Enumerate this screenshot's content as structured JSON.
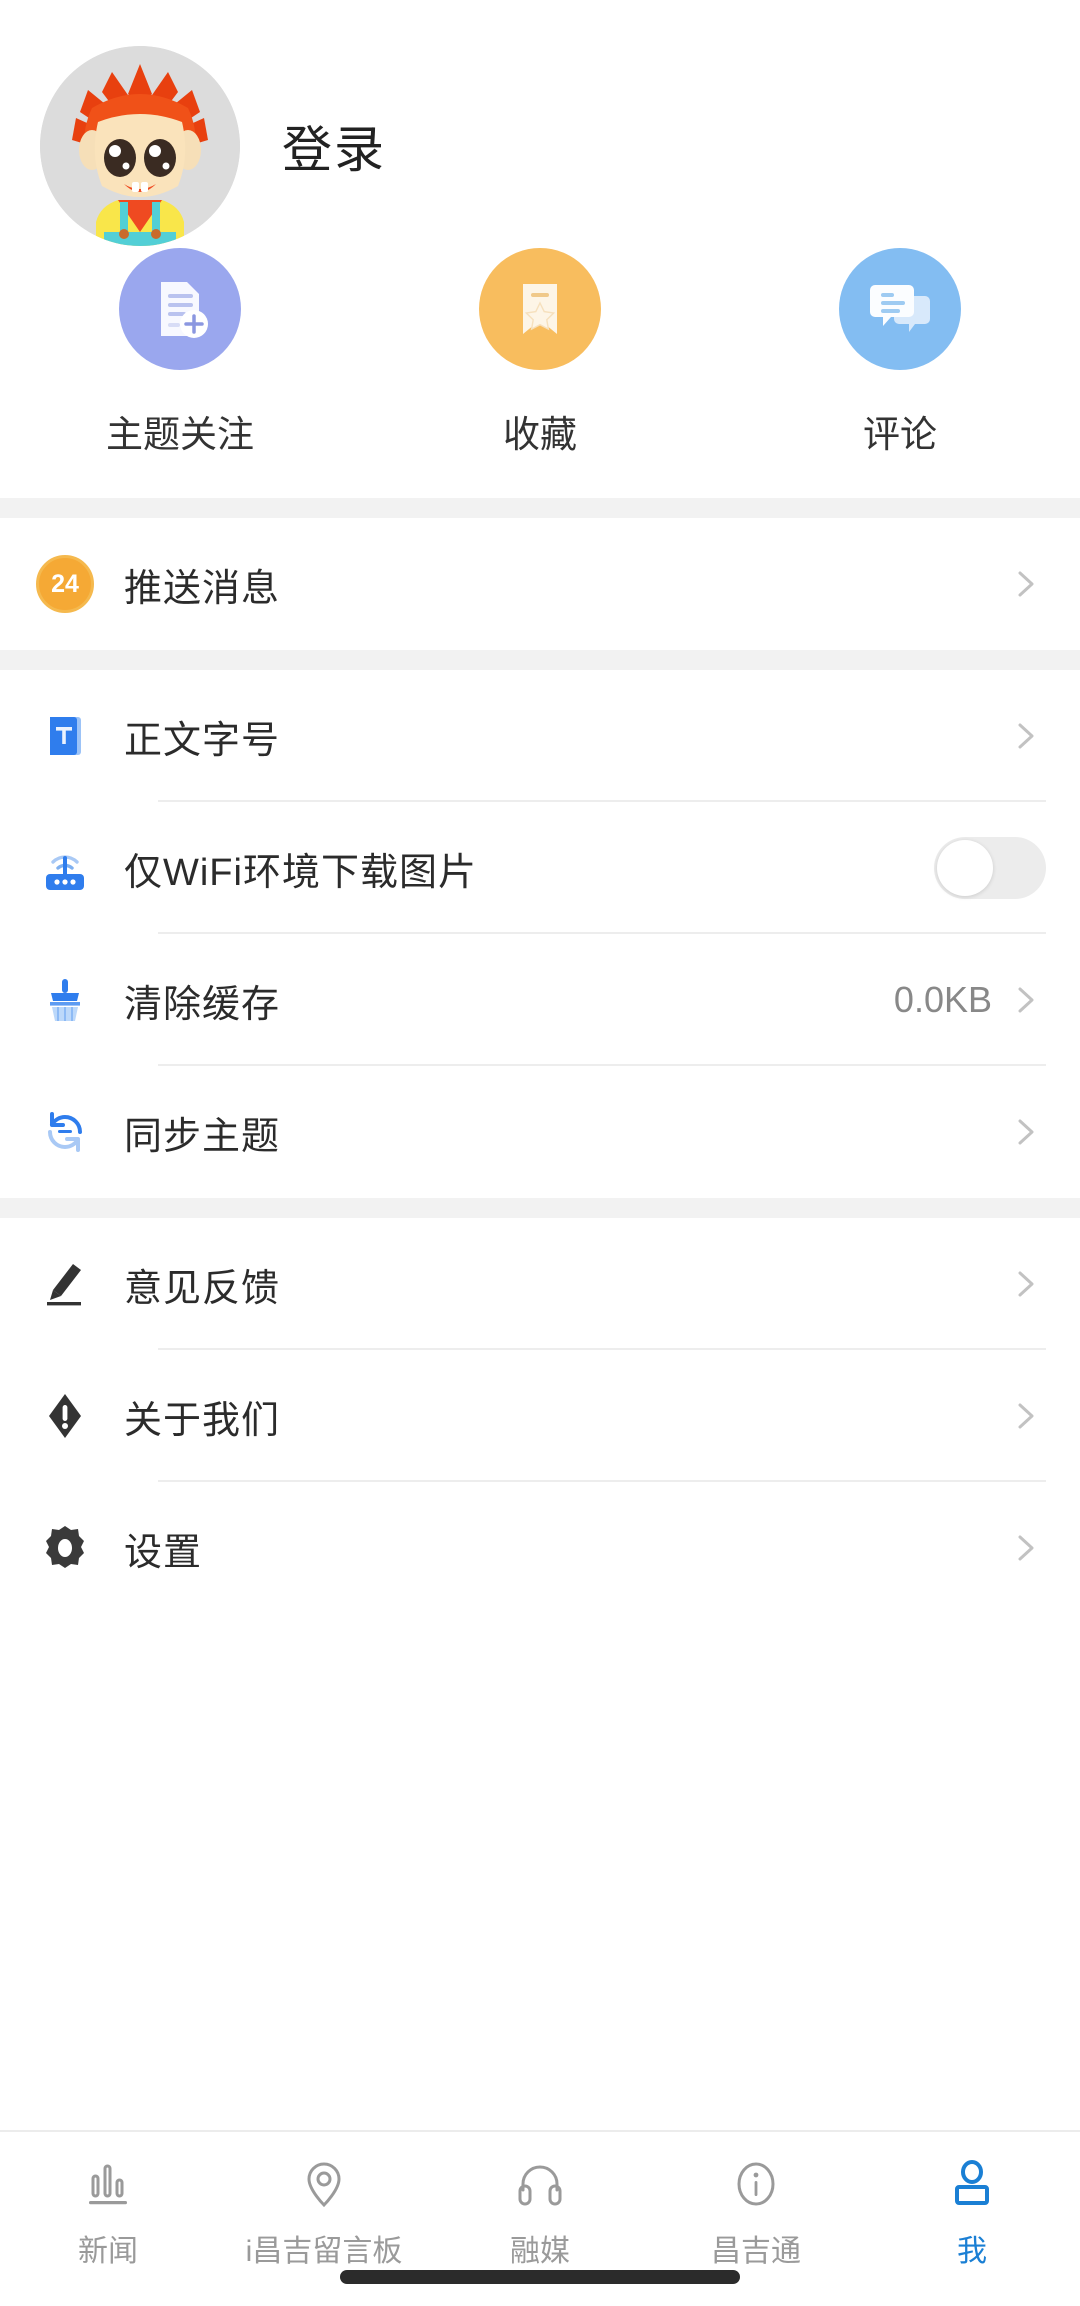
{
  "profile": {
    "avatar_icon": "mascot-avatar",
    "login_label": "登录"
  },
  "quick_actions": [
    {
      "icon": "document-add-icon",
      "label": "主题关注",
      "color": "#9aa7ee"
    },
    {
      "icon": "bookmark-star-icon",
      "label": "收藏",
      "color": "#f7b košice"
    },
    {
      "icon": "comments-icon",
      "label": "评论",
      "color": "#83bdf2"
    }
  ],
  "quick_action_colors": {
    "follow": "#9aa7ee",
    "favorite": "#f8bd5e",
    "comment": "#83bdf2"
  },
  "sections": [
    {
      "name": "messages",
      "rows": [
        {
          "icon": "badge-24-icon",
          "label": "推送消息",
          "value": "",
          "control": "chevron",
          "badge": "24"
        }
      ]
    },
    {
      "name": "preferences",
      "rows": [
        {
          "icon": "text-size-book-icon",
          "label": "正文字号",
          "value": "",
          "control": "chevron"
        },
        {
          "icon": "wifi-router-icon",
          "label": "仅WiFi环境下载图片",
          "value": "",
          "control": "toggle",
          "toggle_on": false
        },
        {
          "icon": "broom-clean-icon",
          "label": "清除缓存",
          "value": "0.0KB",
          "control": "chevron"
        },
        {
          "icon": "sync-refresh-icon",
          "label": "同步主题",
          "value": "",
          "control": "chevron"
        }
      ]
    },
    {
      "name": "about",
      "rows": [
        {
          "icon": "pencil-icon",
          "label": "意见反馈",
          "value": "",
          "control": "chevron"
        },
        {
          "icon": "exclamation-diamond-icon",
          "label": "关于我们",
          "value": "",
          "control": "chevron"
        },
        {
          "icon": "gear-icon",
          "label": "设置",
          "value": "",
          "control": "chevron"
        }
      ]
    }
  ],
  "tabbar": {
    "active_color": "#1a7fd4",
    "inactive_color": "#9a9a9a",
    "items": [
      {
        "icon": "news-bars-icon",
        "label": "新闻",
        "active": false
      },
      {
        "icon": "location-pin-icon",
        "label": "i昌吉留言板",
        "active": false
      },
      {
        "icon": "headphones-icon",
        "label": "融媒",
        "active": false
      },
      {
        "icon": "info-circle-icon",
        "label": "昌吉通",
        "active": false
      },
      {
        "icon": "person-icon",
        "label": "我",
        "active": true
      }
    ]
  }
}
